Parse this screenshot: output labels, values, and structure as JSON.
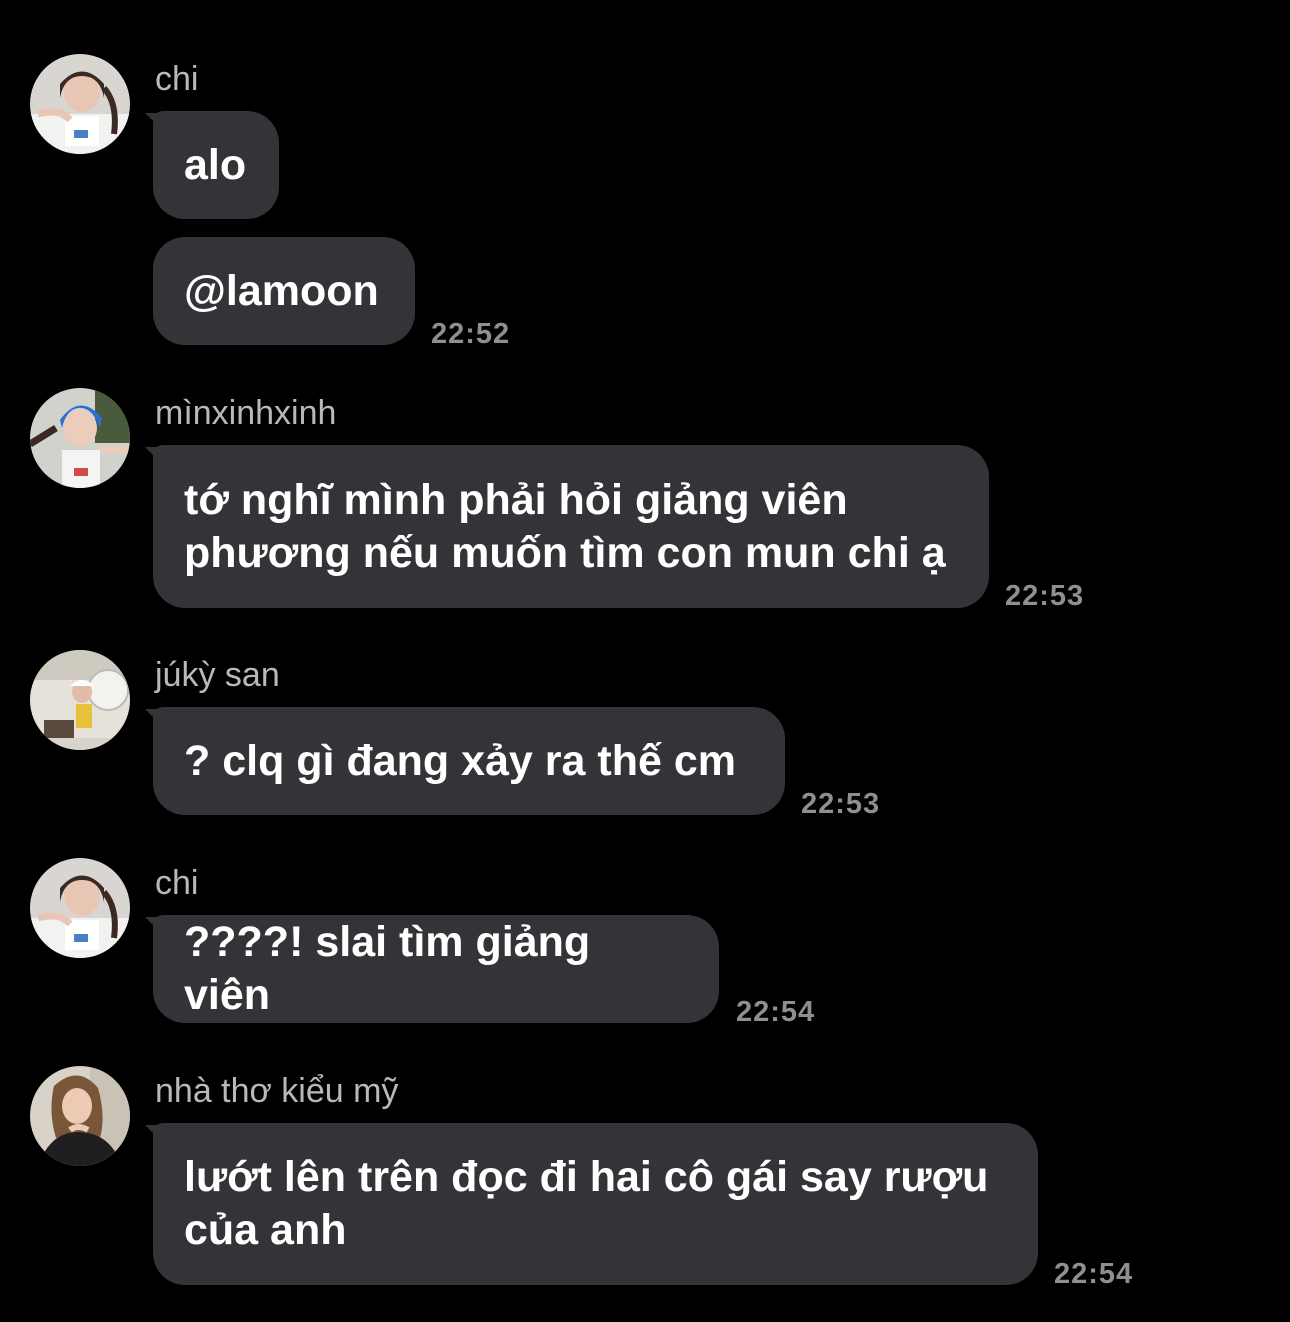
{
  "messages": [
    {
      "sender": "chi",
      "avatar_icon": "avatar-chi",
      "bubbles": [
        "alo",
        "@lamoon"
      ],
      "time": "22:52"
    },
    {
      "sender": "mìnxinhxinh",
      "avatar_icon": "avatar-minxinhxinh",
      "bubbles": [
        "tớ nghĩ mình phải hỏi giảng viên\nphương nếu muốn tìm con mun chi ạ"
      ],
      "time": "22:53"
    },
    {
      "sender": "júkỳ san",
      "avatar_icon": "avatar-juky-san",
      "bubbles": [
        "? clq gì đang xảy ra thế cm"
      ],
      "time": "22:53"
    },
    {
      "sender": "chi",
      "avatar_icon": "avatar-chi",
      "bubbles": [
        "????! slai tìm giảng viên"
      ],
      "time": "22:54"
    },
    {
      "sender": "nhà thơ kiểu mỹ",
      "avatar_icon": "avatar-nha-tho-kieu-my",
      "bubbles": [
        "lướt lên trên đọc đi hai cô gái say rượu\ncủa anh"
      ],
      "time": "22:54"
    }
  ],
  "colors": {
    "background": "#000000",
    "bubble": "#343438",
    "sender_text": "#b8b8bd",
    "time_text": "#8e8e93",
    "message_text": "#ffffff"
  }
}
